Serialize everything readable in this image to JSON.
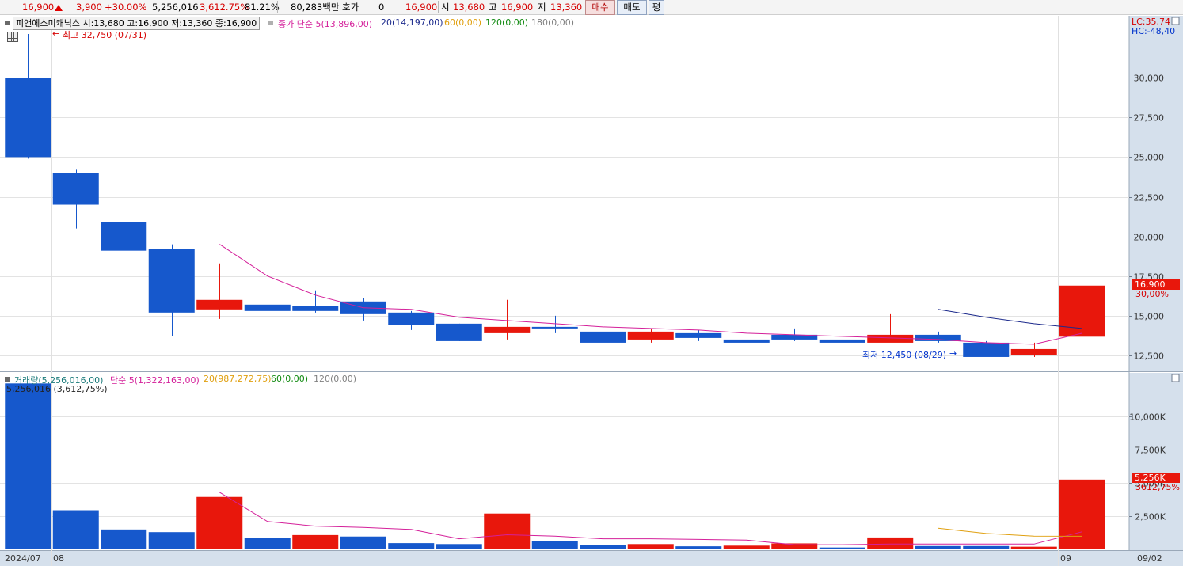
{
  "topbar": {
    "price": "16,900",
    "change": "3,900",
    "change_pct": "+30.00%",
    "volume": "5,256,016",
    "volume_pct": "3,612.75%",
    "ratio": "81.21%",
    "amount": "80,283백만",
    "hoga_label": "호가",
    "hoga_value": "0",
    "hoga_price": "16,900",
    "open_label": "시",
    "open_value": "13,680",
    "high_label": "고",
    "high_value": "16,900",
    "low_label": "저",
    "low_value": "13,360",
    "buy_label": "매수",
    "sell_label": "매도",
    "extra_label": "평"
  },
  "legend": {
    "name_box": "피앤에스미캐닉스 시:13,680 고:16,900 저:13,360 종:16,900",
    "ma5": "종가 단순 5(13,896,00)",
    "ma20": "20(14,197,00)",
    "ma60": "60(0,00)",
    "ma120": "120(0,00)",
    "ma180": "180(0,00)",
    "high_note": "최고 32,750 (07/31)",
    "low_note": "최저 12,450 (08/29)",
    "lc": "LC:35,74",
    "hc": "HC:-48,40",
    "vol_name": "거래량(5,256,016,00)",
    "vol_ma5": "단순 5(1,322,163,00)",
    "vol_ma20": "20(987,272,75)",
    "vol_ma60": "60(0,00)",
    "vol_ma120": "120(0,00)",
    "vol_note": "5,256,016 (3,612,75%)",
    "last_price_tag": "16,900",
    "last_pct_tag": "30,00%",
    "last_vol_tag": "5,256K",
    "last_volpct_tag": "3612,75%"
  },
  "colors": {
    "up": "#e8170c",
    "down": "#1658cc",
    "ma5": "#d4209a",
    "ma20": "#1c2a8c",
    "ma60": "#e0a010",
    "ma120": "#118a11",
    "ma180": "#808080",
    "axis_bg": "#d5e0ec"
  },
  "chart_data": [
    {
      "type": "candlestick",
      "title": "피앤에스미캐닉스",
      "x": [
        "07/31",
        "08/01",
        "08/02",
        "08/05",
        "08/06",
        "08/07",
        "08/08",
        "08/09",
        "08/12",
        "08/13",
        "08/14",
        "08/16",
        "08/19",
        "08/20",
        "08/21",
        "08/22",
        "08/23",
        "08/26",
        "08/27",
        "08/28",
        "08/29",
        "08/30",
        "09/02"
      ],
      "open": [
        30000,
        24000,
        20900,
        19200,
        15400,
        15700,
        15600,
        15900,
        15200,
        14500,
        13900,
        14300,
        14000,
        13500,
        13900,
        13500,
        13800,
        13500,
        13300,
        13800,
        13300,
        12500,
        13680
      ],
      "high": [
        32750,
        24200,
        21500,
        19500,
        18300,
        16800,
        16600,
        16100,
        15300,
        14500,
        16000,
        15000,
        14100,
        14200,
        14100,
        13800,
        14200,
        13700,
        15100,
        14000,
        13400,
        13300,
        16900
      ],
      "low": [
        24900,
        20500,
        19100,
        13700,
        14800,
        15200,
        15200,
        14700,
        14100,
        13400,
        13500,
        13900,
        13300,
        13300,
        13400,
        13300,
        13400,
        13300,
        13400,
        13300,
        12450,
        12400,
        13360
      ],
      "close": [
        25000,
        22000,
        19100,
        15200,
        16000,
        15300,
        15300,
        15100,
        14400,
        13400,
        14300,
        14200,
        13300,
        14000,
        13600,
        13300,
        13500,
        13300,
        13800,
        13400,
        12400,
        12900,
        16900
      ],
      "ma5": [
        null,
        null,
        null,
        null,
        19500,
        17500,
        16300,
        15500,
        15400,
        14900,
        14700,
        14500,
        14300,
        14200,
        14100,
        13900,
        13800,
        13700,
        13600,
        13500,
        13300,
        13200,
        13896
      ],
      "ma20": [
        null,
        null,
        null,
        null,
        null,
        null,
        null,
        null,
        null,
        null,
        null,
        null,
        null,
        null,
        null,
        null,
        null,
        null,
        null,
        15400,
        14900,
        14500,
        14197
      ],
      "ylim": [
        11500,
        33900
      ],
      "y_ticks": [
        12500,
        15000,
        17500,
        20000,
        22500,
        25000,
        27500,
        30000
      ],
      "y_tick_labels": [
        "12,500",
        "15,000",
        "17,500",
        "20,000",
        "22,500",
        "25,000",
        "27,500",
        "30,000"
      ],
      "x_labels": [
        "2024/07",
        "08",
        "09",
        "09/02"
      ]
    },
    {
      "type": "bar",
      "title": "거래량",
      "x": [
        "07/31",
        "08/01",
        "08/02",
        "08/05",
        "08/06",
        "08/07",
        "08/08",
        "08/09",
        "08/12",
        "08/13",
        "08/14",
        "08/16",
        "08/19",
        "08/20",
        "08/21",
        "08/22",
        "08/23",
        "08/26",
        "08/27",
        "08/28",
        "08/29",
        "08/30",
        "09/02"
      ],
      "values": [
        12500,
        2950,
        1500,
        1300,
        3950,
        860,
        1080,
        970,
        470,
        400,
        2700,
        600,
        340,
        400,
        230,
        280,
        450,
        140,
        900,
        250,
        250,
        200,
        5256
      ],
      "up": [
        false,
        false,
        false,
        false,
        true,
        false,
        true,
        false,
        false,
        false,
        true,
        false,
        false,
        true,
        false,
        true,
        true,
        false,
        true,
        false,
        false,
        true,
        true
      ],
      "ma5": [
        null,
        null,
        null,
        null,
        4300,
        2100,
        1750,
        1650,
        1500,
        800,
        1100,
        1000,
        800,
        800,
        750,
        700,
        350,
        350,
        400,
        400,
        400,
        400,
        1322
      ],
      "ma20": [
        null,
        null,
        null,
        null,
        null,
        null,
        null,
        null,
        null,
        null,
        null,
        null,
        null,
        null,
        null,
        null,
        null,
        null,
        null,
        1600,
        1200,
        1000,
        987
      ],
      "unit": "K",
      "ylim": [
        0,
        12400
      ],
      "y_ticks": [
        2500,
        5000,
        7500,
        10000
      ],
      "y_tick_labels": [
        "2,500K",
        "5,000K",
        "7,500K",
        "10,000K"
      ]
    }
  ]
}
